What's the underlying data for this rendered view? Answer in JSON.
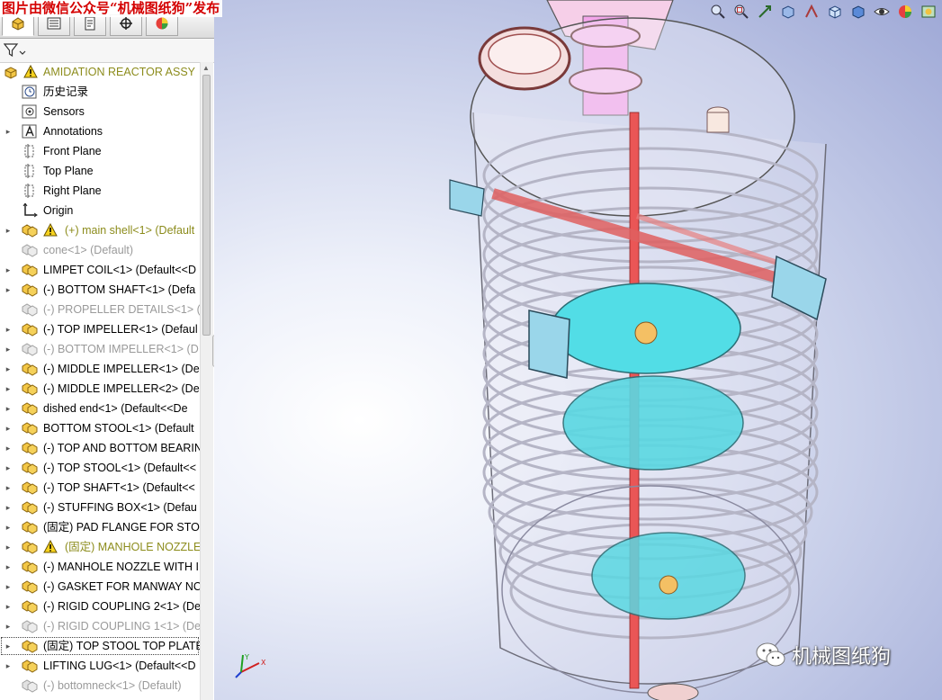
{
  "watermark": {
    "top": "图片由微信公众号“机械图纸狗”发布",
    "bottom_right": "机械图纸狗"
  },
  "tabs": [
    {
      "name": "tab-featuremanager",
      "icon": "feature-tree-icon"
    },
    {
      "name": "tab-propertymanager",
      "icon": "property-list-icon"
    },
    {
      "name": "tab-configurationmanager",
      "icon": "configuration-icon"
    },
    {
      "name": "tab-dimxpert",
      "icon": "crosshair-icon"
    },
    {
      "name": "tab-display",
      "icon": "appearance-icon"
    }
  ],
  "tree": {
    "root": {
      "label": "AMIDATION REACTOR ASSY",
      "warning": true
    },
    "items": [
      {
        "label": "历史记录",
        "icon": "history-icon",
        "expand": false,
        "state": "normal"
      },
      {
        "label": "Sensors",
        "icon": "sensors-icon",
        "expand": false,
        "state": "normal"
      },
      {
        "label": "Annotations",
        "icon": "annotations-icon",
        "expand": true,
        "state": "normal"
      },
      {
        "label": "Front Plane",
        "icon": "plane-icon",
        "expand": false,
        "state": "normal"
      },
      {
        "label": "Top Plane",
        "icon": "plane-icon",
        "expand": false,
        "state": "normal"
      },
      {
        "label": "Right Plane",
        "icon": "plane-icon",
        "expand": false,
        "state": "normal"
      },
      {
        "label": "Origin",
        "icon": "origin-icon",
        "expand": false,
        "state": "normal"
      },
      {
        "label": "(+) main shell<1> (Default",
        "icon": "part-icon",
        "expand": true,
        "state": "warning"
      },
      {
        "label": "cone<1> (Default)",
        "icon": "part-icon",
        "expand": false,
        "state": "suppressed"
      },
      {
        "label": "LIMPET COIL<1> (Default<<D",
        "icon": "part-icon",
        "expand": true,
        "state": "normal"
      },
      {
        "label": "(-) BOTTOM SHAFT<1> (Defa",
        "icon": "part-icon",
        "expand": true,
        "state": "normal"
      },
      {
        "label": "(-) PROPELLER DETAILS<1> (D",
        "icon": "part-icon",
        "expand": false,
        "state": "suppressed"
      },
      {
        "label": "(-) TOP IMPELLER<1> (Defaul",
        "icon": "part-icon",
        "expand": true,
        "state": "normal"
      },
      {
        "label": "(-) BOTTOM IMPELLER<1> (D",
        "icon": "part-icon",
        "expand": true,
        "state": "suppressed"
      },
      {
        "label": "(-) MIDDLE IMPELLER<1> (De",
        "icon": "part-icon",
        "expand": true,
        "state": "normal"
      },
      {
        "label": "(-) MIDDLE IMPELLER<2> (De",
        "icon": "part-icon",
        "expand": true,
        "state": "normal"
      },
      {
        "label": "dished end<1> (Default<<De",
        "icon": "part-icon",
        "expand": true,
        "state": "normal"
      },
      {
        "label": "BOTTOM STOOL<1> (Default",
        "icon": "part-icon",
        "expand": true,
        "state": "normal"
      },
      {
        "label": "(-) TOP AND BOTTOM BEARIN",
        "icon": "part-icon",
        "expand": true,
        "state": "normal"
      },
      {
        "label": "(-) TOP STOOL<1> (Default<<",
        "icon": "part-icon",
        "expand": true,
        "state": "normal"
      },
      {
        "label": "(-) TOP SHAFT<1> (Default<<",
        "icon": "part-icon",
        "expand": true,
        "state": "normal"
      },
      {
        "label": "(-) STUFFING BOX<1> (Defau",
        "icon": "part-icon",
        "expand": true,
        "state": "normal"
      },
      {
        "label": "(固定) PAD FLANGE FOR STOC",
        "icon": "part-icon",
        "expand": true,
        "state": "normal"
      },
      {
        "label": "(固定) MANHOLE NOZZLE",
        "icon": "part-icon",
        "expand": true,
        "state": "warning"
      },
      {
        "label": "(-) MANHOLE NOZZLE WITH I",
        "icon": "part-icon",
        "expand": true,
        "state": "normal"
      },
      {
        "label": "(-) GASKET FOR MANWAY NC",
        "icon": "part-icon",
        "expand": true,
        "state": "normal"
      },
      {
        "label": "(-) RIGID COUPLING 2<1> (De",
        "icon": "part-icon",
        "expand": true,
        "state": "normal"
      },
      {
        "label": "(-) RIGID COUPLING 1<1> (De",
        "icon": "part-icon",
        "expand": true,
        "state": "suppressed"
      },
      {
        "label": "(固定) TOP STOOL TOP PLATE",
        "icon": "part-icon",
        "expand": true,
        "state": "selected"
      },
      {
        "label": "LIFTING LUG<1> (Default<<D",
        "icon": "part-icon",
        "expand": true,
        "state": "normal"
      },
      {
        "label": "(-) bottomneck<1> (Default)",
        "icon": "part-icon",
        "expand": false,
        "state": "suppressed"
      }
    ]
  },
  "hud": [
    "zoom-to-fit-icon",
    "zoom-area-icon",
    "previous-view-icon",
    "section-view-icon",
    "dynamic-annotation-icon",
    "view-orientation-icon",
    "display-style-icon",
    "hide-show-icon",
    "edit-appearance-icon",
    "apply-scene-icon"
  ],
  "colors": {
    "shell": "#8a8fa8",
    "impeller": "#4fd6e0",
    "shaft": "#e8504a",
    "coil": "#c8c8d4",
    "pink": "#f2a0e6",
    "lug": "#8ed0e8"
  }
}
